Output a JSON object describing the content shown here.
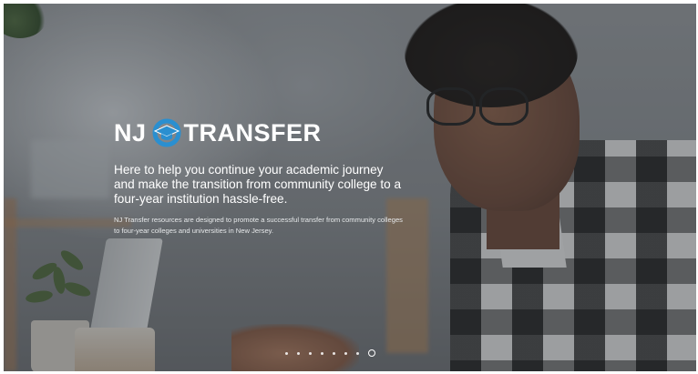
{
  "hero": {
    "brand": {
      "prefix": "NJ",
      "suffix": "TRANSFER"
    },
    "tagline": "Here to help you continue your academic journey and make the transition from community college to a four-year institution hassle-free.",
    "description": "NJ Transfer resources are designed to promote a successful transfer from community colleges to four-year colleges and universities in New Jersey.",
    "logo_icon": "graduation-cap-circle-icon"
  },
  "carousel": {
    "slide_count": 8,
    "active_index": 7
  },
  "colors": {
    "logo_accent": "#2a8fd0",
    "text": "#ffffff"
  }
}
